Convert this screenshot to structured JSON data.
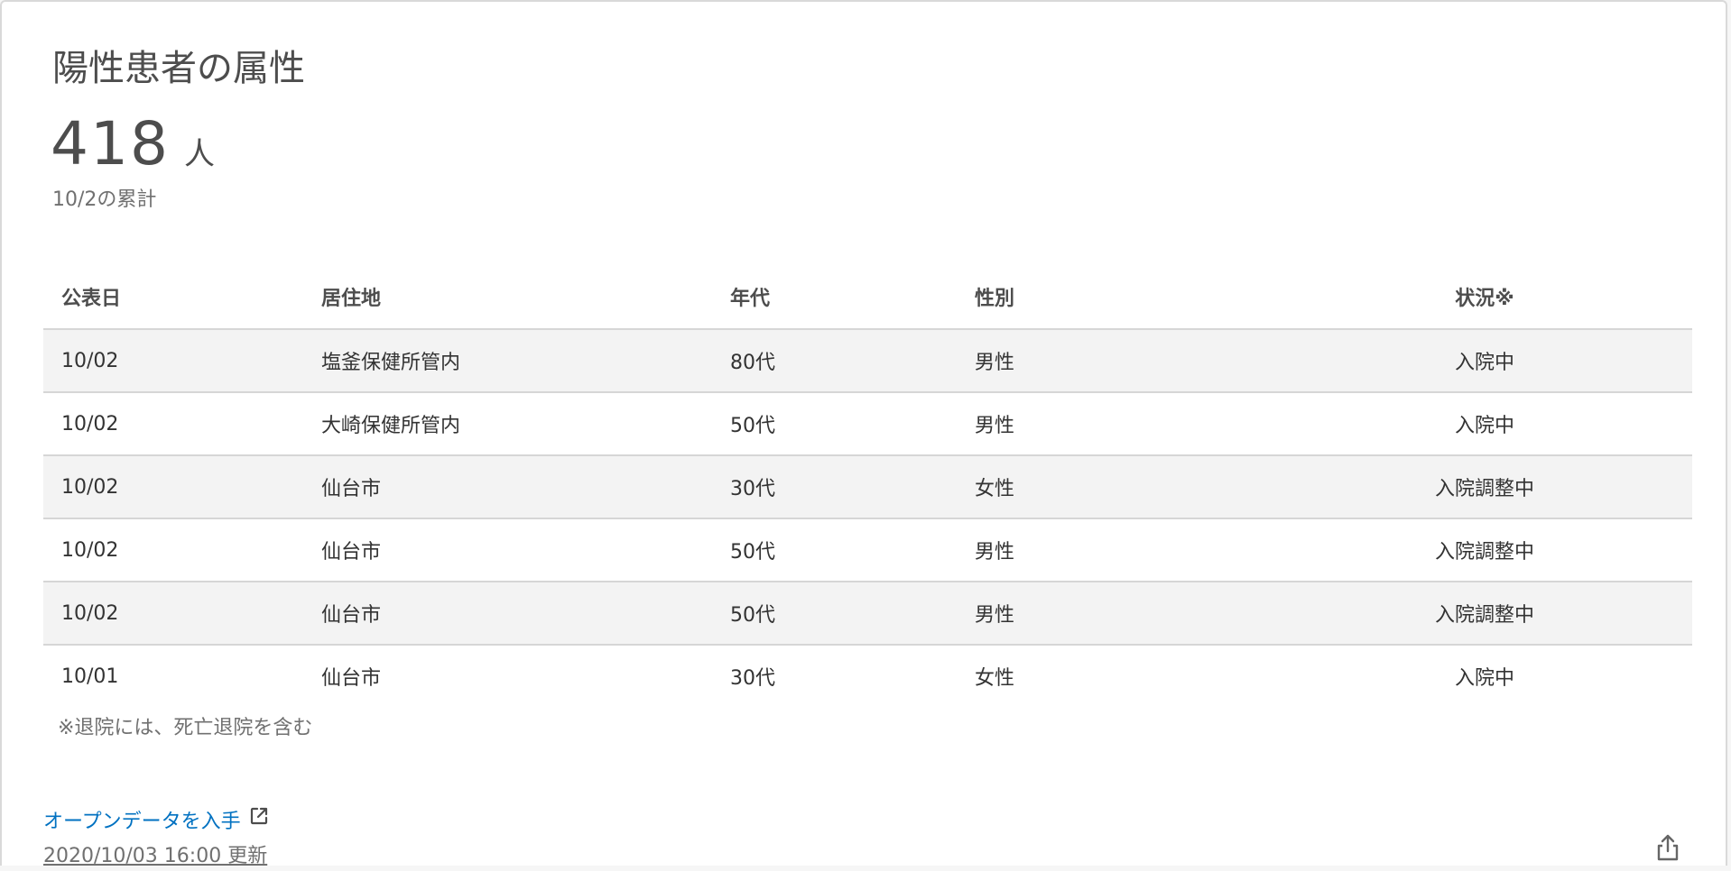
{
  "card": {
    "title": "陽性患者の属性",
    "total_number": "418",
    "total_unit": "人",
    "total_date": "10/2の累計"
  },
  "table": {
    "headers": {
      "date": "公表日",
      "residence": "居住地",
      "age": "年代",
      "gender": "性別",
      "status": "状況※"
    },
    "rows": [
      {
        "date": "10/02",
        "residence": "塩釜保健所管内",
        "age": "80代",
        "gender": "男性",
        "status": "入院中"
      },
      {
        "date": "10/02",
        "residence": "大崎保健所管内",
        "age": "50代",
        "gender": "男性",
        "status": "入院中"
      },
      {
        "date": "10/02",
        "residence": "仙台市",
        "age": "30代",
        "gender": "女性",
        "status": "入院調整中"
      },
      {
        "date": "10/02",
        "residence": "仙台市",
        "age": "50代",
        "gender": "男性",
        "status": "入院調整中"
      },
      {
        "date": "10/02",
        "residence": "仙台市",
        "age": "50代",
        "gender": "男性",
        "status": "入院調整中"
      },
      {
        "date": "10/01",
        "residence": "仙台市",
        "age": "30代",
        "gender": "女性",
        "status": "入院中"
      }
    ]
  },
  "footnote": "※退院には、死亡退院を含む",
  "footer": {
    "open_data_label": "オープンデータを入手",
    "open_data_icon": "external-link-icon",
    "updated_label": "2020/10/03 16:00 更新",
    "share_icon": "share-icon"
  },
  "colors": {
    "link": "#0071c1",
    "text": "#4d4d4d",
    "row_stripe": "#f3f3f3",
    "border": "#d6d6d6"
  }
}
